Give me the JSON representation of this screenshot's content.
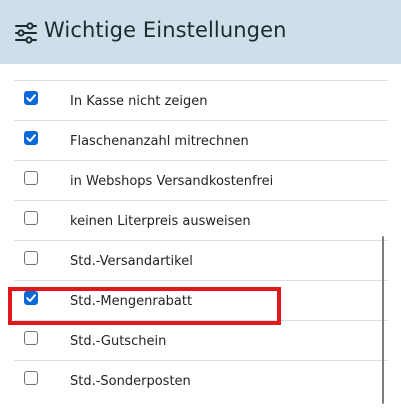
{
  "header": {
    "title": "Wichtige Einstellungen",
    "icon": "sliders-icon",
    "background": "#cfdfe9"
  },
  "items": [
    {
      "label": "In Kasse nicht zeigen",
      "checked": true
    },
    {
      "label": "Flaschenanzahl mitrechnen",
      "checked": true
    },
    {
      "label": "in Webshops Versandkostenfrei",
      "checked": false
    },
    {
      "label": "keinen Literpreis ausweisen",
      "checked": false
    },
    {
      "label": "Std.-Versandartikel",
      "checked": false
    },
    {
      "label": "Std.-Mengenrabatt",
      "checked": true,
      "highlighted": true
    },
    {
      "label": "Std.-Gutschein",
      "checked": false
    },
    {
      "label": "Std.-Sonderposten",
      "checked": false
    }
  ],
  "colors": {
    "checkbox_checked": "#0a69d6",
    "highlight_border": "#e0181c"
  }
}
